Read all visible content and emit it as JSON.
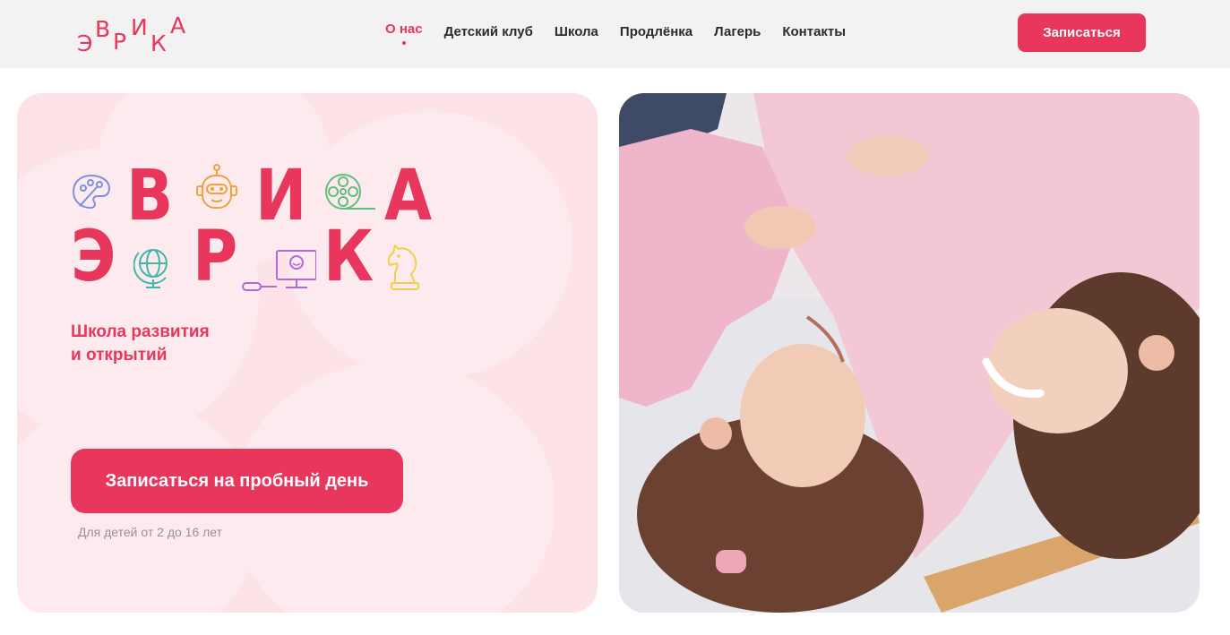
{
  "header": {
    "logo_letters": [
      "Э",
      "В",
      "Р",
      "И",
      "К",
      "А"
    ],
    "nav": [
      {
        "label": "О нас",
        "active": true
      },
      {
        "label": "Детский клуб",
        "active": false
      },
      {
        "label": "Школа",
        "active": false
      },
      {
        "label": "Продлёнка",
        "active": false
      },
      {
        "label": "Лагерь",
        "active": false
      },
      {
        "label": "Контакты",
        "active": false
      }
    ],
    "signup_label": "Записаться"
  },
  "hero": {
    "logo_letters": [
      "Э",
      "В",
      "Р",
      "И",
      "К",
      "А"
    ],
    "tagline_line1": "Школа развития",
    "tagline_line2": "и открытий",
    "cta_label": "Записаться на пробный день",
    "age_note": "Для детей от 2 до 16 лет",
    "icons": [
      "palette-icon",
      "robot-icon",
      "film-reel-icon",
      "globe-icon",
      "computer-icon",
      "chess-knight-icon"
    ]
  },
  "photo": {
    "subject": "mother-and-daughter-photo"
  },
  "colors": {
    "brand": "#e8365d",
    "header_bg": "#f1f2f1",
    "card_bg": "#fde3e8",
    "icon_blue": "#7b8fe0",
    "icon_orange": "#f2a23a",
    "icon_green": "#5fbf7a",
    "icon_teal": "#3fb8a8",
    "icon_purple": "#b06ad6",
    "icon_yellow": "#f2cf4a"
  }
}
